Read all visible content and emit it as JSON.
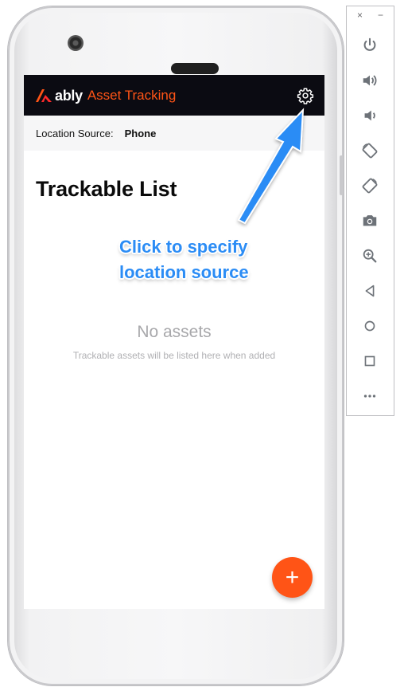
{
  "app": {
    "logo_word": "ably",
    "logo_product": "Asset Tracking"
  },
  "location_source": {
    "label": "Location Source:",
    "value": "Phone"
  },
  "page_title": "Trackable List",
  "empty_state": {
    "title": "No assets",
    "subtitle": "Trackable assets will be listed here when added"
  },
  "fab": {
    "label": "+"
  },
  "annotation": {
    "line1": "Click to specify",
    "line2": "location source"
  },
  "emulator_toolbar": {
    "close": "×",
    "minimize": "−",
    "items": [
      "power-icon",
      "volume-up-icon",
      "volume-down-icon",
      "rotate-left-icon",
      "rotate-right-icon",
      "camera-icon",
      "zoom-icon",
      "back-icon",
      "home-icon",
      "overview-icon",
      "more-icon"
    ]
  },
  "colors": {
    "brand": "#ff5416",
    "appbar": "#0b0b12",
    "annotation": "#2b8cf5"
  }
}
